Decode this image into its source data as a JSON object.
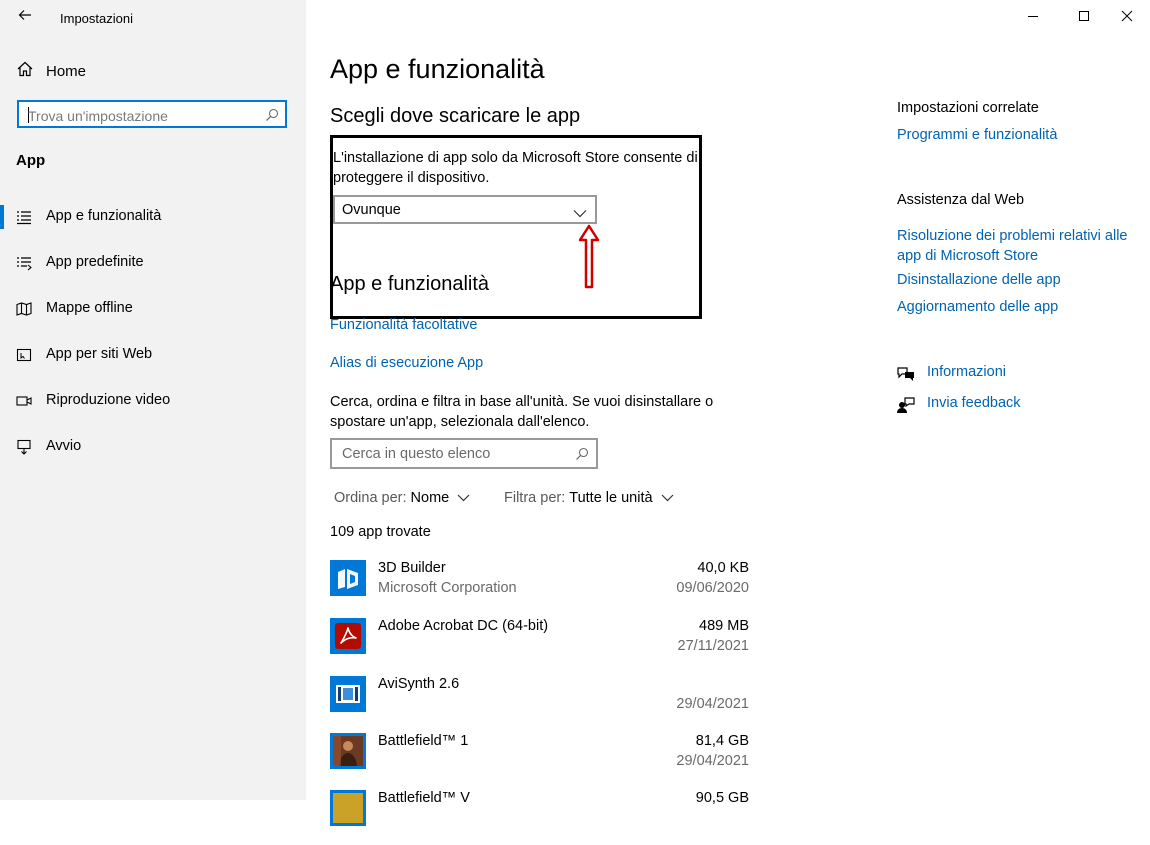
{
  "window": {
    "title": "Impostazioni",
    "controls": [
      "minimize",
      "maximize",
      "close"
    ]
  },
  "sidebar": {
    "home_label": "Home",
    "search_placeholder": "Trova un'impostazione",
    "section_title": "App",
    "items": [
      {
        "label": "App e funzionalità",
        "icon": "list-icon",
        "active": true
      },
      {
        "label": "App predefinite",
        "icon": "default-apps-icon",
        "active": false
      },
      {
        "label": "Mappe offline",
        "icon": "map-icon",
        "active": false
      },
      {
        "label": "App per siti Web",
        "icon": "website-apps-icon",
        "active": false
      },
      {
        "label": "Riproduzione video",
        "icon": "video-icon",
        "active": false
      },
      {
        "label": "Avvio",
        "icon": "startup-icon",
        "active": false
      }
    ]
  },
  "main": {
    "title": "App e funzionalità",
    "choose_heading": "Scegli dove scaricare le app",
    "choose_desc": "L'installazione di app solo da Microsoft Store consente di proteggere il dispositivo.",
    "dropdown_value": "Ovunque",
    "apps_heading": "App e funzionalità",
    "optional_features_link": "Funzionalità facoltative",
    "app_alias_link": "Alias di esecuzione App",
    "search_desc": "Cerca, ordina e filtra in base all'unità. Se vuoi disinstallare o spostare un'app, selezionala dall'elenco.",
    "list_search_placeholder": "Cerca in questo elenco",
    "sort_label": "Ordina per:",
    "sort_value": "Nome",
    "filter_label": "Filtra per:",
    "filter_value": "Tutte le unità",
    "count_text": "109 app trovate",
    "apps": [
      {
        "name": "3D Builder",
        "publisher": "Microsoft Corporation",
        "size": "40,0 KB",
        "date": "09/06/2020",
        "icon": "3d-builder-icon"
      },
      {
        "name": "Adobe Acrobat DC (64-bit)",
        "publisher": "",
        "size": "489 MB",
        "date": "27/11/2021",
        "icon": "acrobat-icon"
      },
      {
        "name": "AviSynth 2.6",
        "publisher": "",
        "size": "",
        "date": "29/04/2021",
        "icon": "avisynth-icon"
      },
      {
        "name": "Battlefield™ 1",
        "publisher": "",
        "size": "81,4 GB",
        "date": "29/04/2021",
        "icon": "battlefield1-icon"
      },
      {
        "name": "Battlefield™ V",
        "publisher": "",
        "size": "90,5 GB",
        "date": "",
        "icon": "battlefield5-icon"
      }
    ]
  },
  "right": {
    "related_title": "Impostazioni correlate",
    "related_link": "Programmi e funzionalità",
    "web_help_title": "Assistenza dal Web",
    "web_links": [
      "Risoluzione dei problemi relativi alle app di Microsoft Store",
      "Disinstallazione delle app",
      "Aggiornamento delle app"
    ],
    "info_label": "Informazioni",
    "feedback_label": "Invia feedback"
  },
  "colors": {
    "accent": "#0078d7",
    "link": "#0063b1",
    "sidebar_bg": "#f2f2f2",
    "annotation_arrow": "#d00000"
  }
}
